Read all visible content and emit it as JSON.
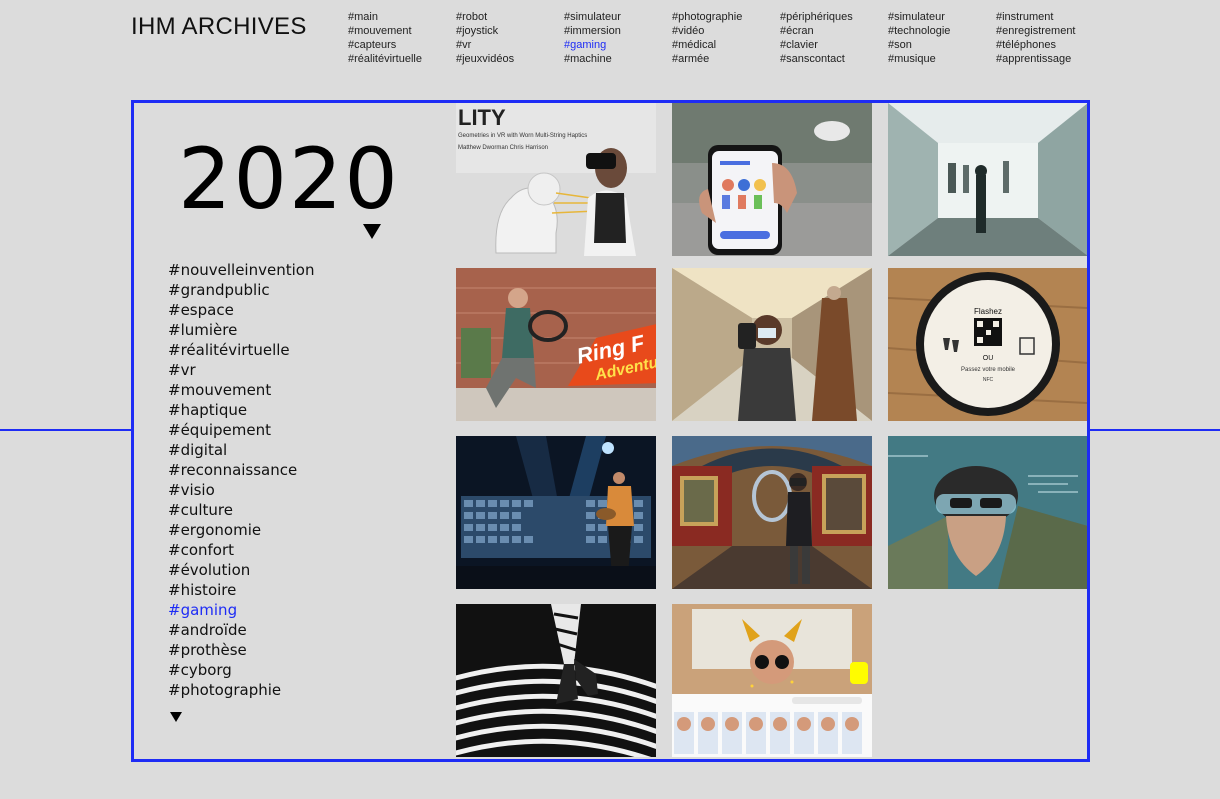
{
  "site": {
    "title": "IHM ARCHIVES"
  },
  "topnav": {
    "columns": [
      [
        "#main",
        "#mouvement",
        "#capteurs",
        "#réalitévirtuelle"
      ],
      [
        "#robot",
        "#joystick",
        "#vr",
        "#jeuxvidéos"
      ],
      [
        "#simulateur",
        "#immersion",
        "#gaming",
        "#machine"
      ],
      [
        "#photographie",
        "#vidéo",
        "#médical",
        "#armée"
      ],
      [
        "#périphériques",
        "#écran",
        "#clavier",
        "#sanscontact"
      ],
      [
        "#simulateur",
        "#technologie",
        "#son",
        "#musique"
      ],
      [
        "#instrument",
        "#enregistrement",
        "#téléphones",
        "#apprentissage"
      ]
    ],
    "active": "#gaming"
  },
  "year": {
    "label": "2020"
  },
  "tags": {
    "items": [
      "#nouvelleinvention",
      "#grandpublic",
      "#espace",
      "#lumière",
      "#réalitévirtuelle",
      "#vr",
      "#mouvement",
      "#haptique",
      "#équipement",
      "#digital",
      "#reconnaissance",
      "#visio",
      "#culture",
      "#ergonomie",
      "#confort",
      "#évolution",
      "#histoire",
      "#gaming",
      "#androïde",
      "#prothèse",
      "#cyborg",
      "#photographie"
    ],
    "active": "#gaming"
  },
  "accent_color": "#1e2cf5",
  "gallery": {
    "images": [
      {
        "name": "vr-haptics-lion",
        "text_lines": [
          "LITY",
          "Geometries in VR with Worn Multi-String Haptics",
          "Matthew Dworman   Chris Harrison"
        ]
      },
      {
        "name": "smartphone-app"
      },
      {
        "name": "projection-room"
      },
      {
        "name": "ring-fit-adventure",
        "text_lines": [
          "Ring F",
          "Adventur"
        ]
      },
      {
        "name": "mall-vr-woman"
      },
      {
        "name": "qr-code-sticker",
        "text_lines": [
          "Flashez",
          "OU",
          "Passez votre mobile",
          "NFC"
        ]
      },
      {
        "name": "virtual-concert"
      },
      {
        "name": "museum-vr"
      },
      {
        "name": "hololens-soldier"
      },
      {
        "name": "optical-stripes-runner"
      },
      {
        "name": "snapchat-filters"
      }
    ]
  }
}
